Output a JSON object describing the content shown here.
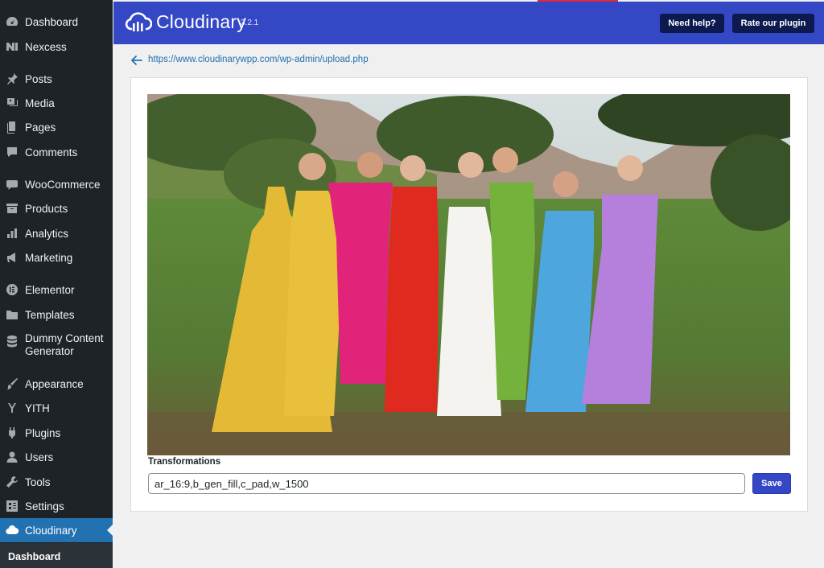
{
  "sidebar": {
    "items": [
      {
        "label": "Dashboard",
        "icon": "dashboard-icon"
      },
      {
        "label": "Nexcess",
        "icon": "nexcess-icon"
      },
      {
        "label": "Posts",
        "icon": "pin-icon"
      },
      {
        "label": "Media",
        "icon": "media-icon"
      },
      {
        "label": "Pages",
        "icon": "pages-icon"
      },
      {
        "label": "Comments",
        "icon": "comment-icon"
      },
      {
        "label": "WooCommerce",
        "icon": "woo-icon"
      },
      {
        "label": "Products",
        "icon": "archive-icon"
      },
      {
        "label": "Analytics",
        "icon": "bar-chart-icon"
      },
      {
        "label": "Marketing",
        "icon": "megaphone-icon"
      },
      {
        "label": "Elementor",
        "icon": "elementor-icon"
      },
      {
        "label": "Templates",
        "icon": "folder-icon"
      },
      {
        "label_line1": "Dummy Content",
        "label_line2": "Generator",
        "icon": "database-icon"
      },
      {
        "label": "Appearance",
        "icon": "brush-icon"
      },
      {
        "label": "YITH",
        "icon": "yith-icon"
      },
      {
        "label": "Plugins",
        "icon": "plug-icon"
      },
      {
        "label": "Users",
        "icon": "user-icon"
      },
      {
        "label": "Tools",
        "icon": "wrench-icon"
      },
      {
        "label": "Settings",
        "icon": "settings-icon"
      },
      {
        "label": "Cloudinary",
        "icon": "cloud-icon",
        "active": true
      }
    ],
    "submenu": {
      "label": "Dashboard"
    }
  },
  "header": {
    "brand": "Cloudinary",
    "version": "3.2.1",
    "help_button": "Need help?",
    "rate_button": "Rate our plugin"
  },
  "url_row": {
    "url": "https://www.cloudinarywpp.com/wp-admin/upload.php"
  },
  "editor": {
    "transformations_label": "Transformations",
    "transformations_value": "ar_16:9,b_gen_fill,c_pad,w_1500",
    "save_label": "Save"
  },
  "colors": {
    "sidebar_bg": "#1d2327",
    "active_item": "#2271b1",
    "header_bg": "#3448c5",
    "header_button_bg": "#0c1a4f",
    "link": "#2271b1"
  }
}
